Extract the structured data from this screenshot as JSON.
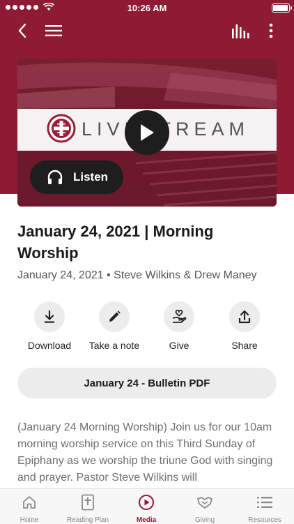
{
  "status_bar": {
    "time": "10:26 AM"
  },
  "colors": {
    "brand": "#8e1a33",
    "button_bg": "#ececec",
    "dark_pill": "#1e1e1e"
  },
  "media": {
    "banner_text": "LIVESTREAM",
    "listen_label": "Listen"
  },
  "sermon": {
    "title": "January 24, 2021 | Morning Worship",
    "meta": "January 24, 2021 • Steve Wilkins & Drew Maney",
    "description": "(January 24 Morning Worship) Join us for our 10am morning worship service on this Third Sunday of Epiphany as we worship the triune God with singing and prayer. Pastor Steve Wilkins will"
  },
  "actions": [
    {
      "label": "Download",
      "icon": "download-icon"
    },
    {
      "label": "Take a note",
      "icon": "pencil-icon"
    },
    {
      "label": "Give",
      "icon": "giving-hand-icon"
    },
    {
      "label": "Share",
      "icon": "share-icon"
    }
  ],
  "bulletin_label": "January 24 - Bulletin PDF",
  "tabs": [
    {
      "label": "Home",
      "icon": "home-icon",
      "active": false
    },
    {
      "label": "Reading Plan",
      "icon": "bible-icon",
      "active": false
    },
    {
      "label": "Media",
      "icon": "play-icon",
      "active": true
    },
    {
      "label": "Giving",
      "icon": "giving-hand-icon",
      "active": false
    },
    {
      "label": "Resources",
      "icon": "list-icon",
      "active": false
    }
  ]
}
